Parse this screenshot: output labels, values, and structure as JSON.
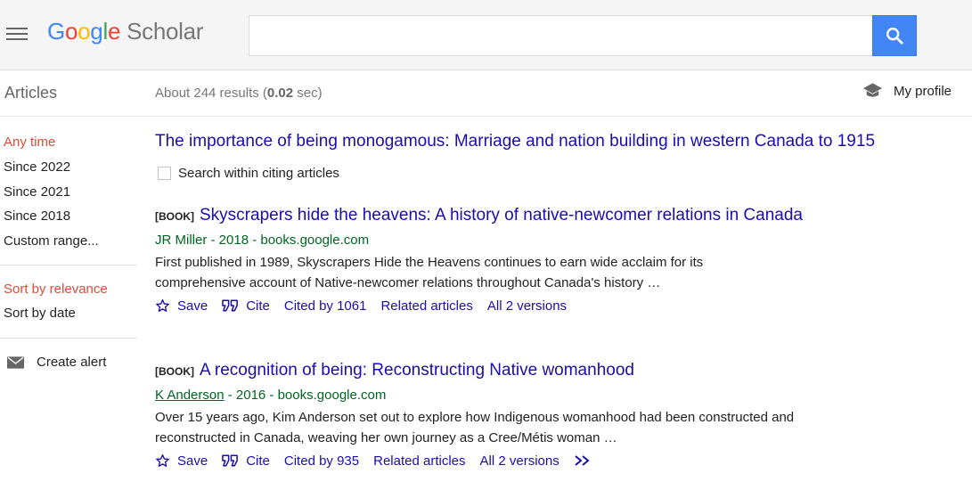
{
  "header": {
    "logo_google": [
      "G",
      "o",
      "o",
      "g",
      "l",
      "e"
    ],
    "logo_scholar": "Scholar",
    "search_value": "",
    "search_placeholder": ""
  },
  "subheader": {
    "section": "Articles",
    "results_prefix": "About 244 results (",
    "results_time": "0.02",
    "results_suffix": " sec)",
    "profile_label": "My profile"
  },
  "sidebar": {
    "time_filters": [
      "Any time",
      "Since 2022",
      "Since 2021",
      "Since 2018",
      "Custom range..."
    ],
    "sort_options": [
      "Sort by relevance",
      "Sort by date"
    ],
    "alert_label": "Create alert"
  },
  "main": {
    "cited_title": "The importance of being monogamous: Marriage and nation building in western Canada to 1915",
    "within_label": "Search within citing articles",
    "results": [
      {
        "tag": "[BOOK]",
        "title": "Skyscrapers hide the heavens: A history of native-newcomer relations in Canada",
        "author": "JR Miller",
        "meta_rest": " - 2018 - books.google.com",
        "snippet": "First published in 1989, Skyscrapers Hide the Heavens continues to earn wide acclaim for its comprehensive account of Native-newcomer relations throughout Canada's history …",
        "save": "Save",
        "cite": "Cite",
        "cited_by": "Cited by 1061",
        "related": "Related articles",
        "versions": "All 2 versions"
      },
      {
        "tag": "[BOOK]",
        "title": "A recognition of being: Reconstructing Native womanhood",
        "author": "K Anderson",
        "meta_rest": " - 2016 - books.google.com",
        "snippet": "Over 15 years ago, Kim Anderson set out to explore how Indigenous womanhood had been constructed and reconstructed in Canada, weaving her own journey as a Cree/Métis woman …",
        "save": "Save",
        "cite": "Cite",
        "cited_by": "Cited by 935",
        "related": "Related articles",
        "versions": "All 2 versions"
      }
    ]
  },
  "colors": {
    "link": "#1a0dab",
    "meta_green": "#006621",
    "active_red": "#dd4b39",
    "search_blue": "#4285f4"
  }
}
